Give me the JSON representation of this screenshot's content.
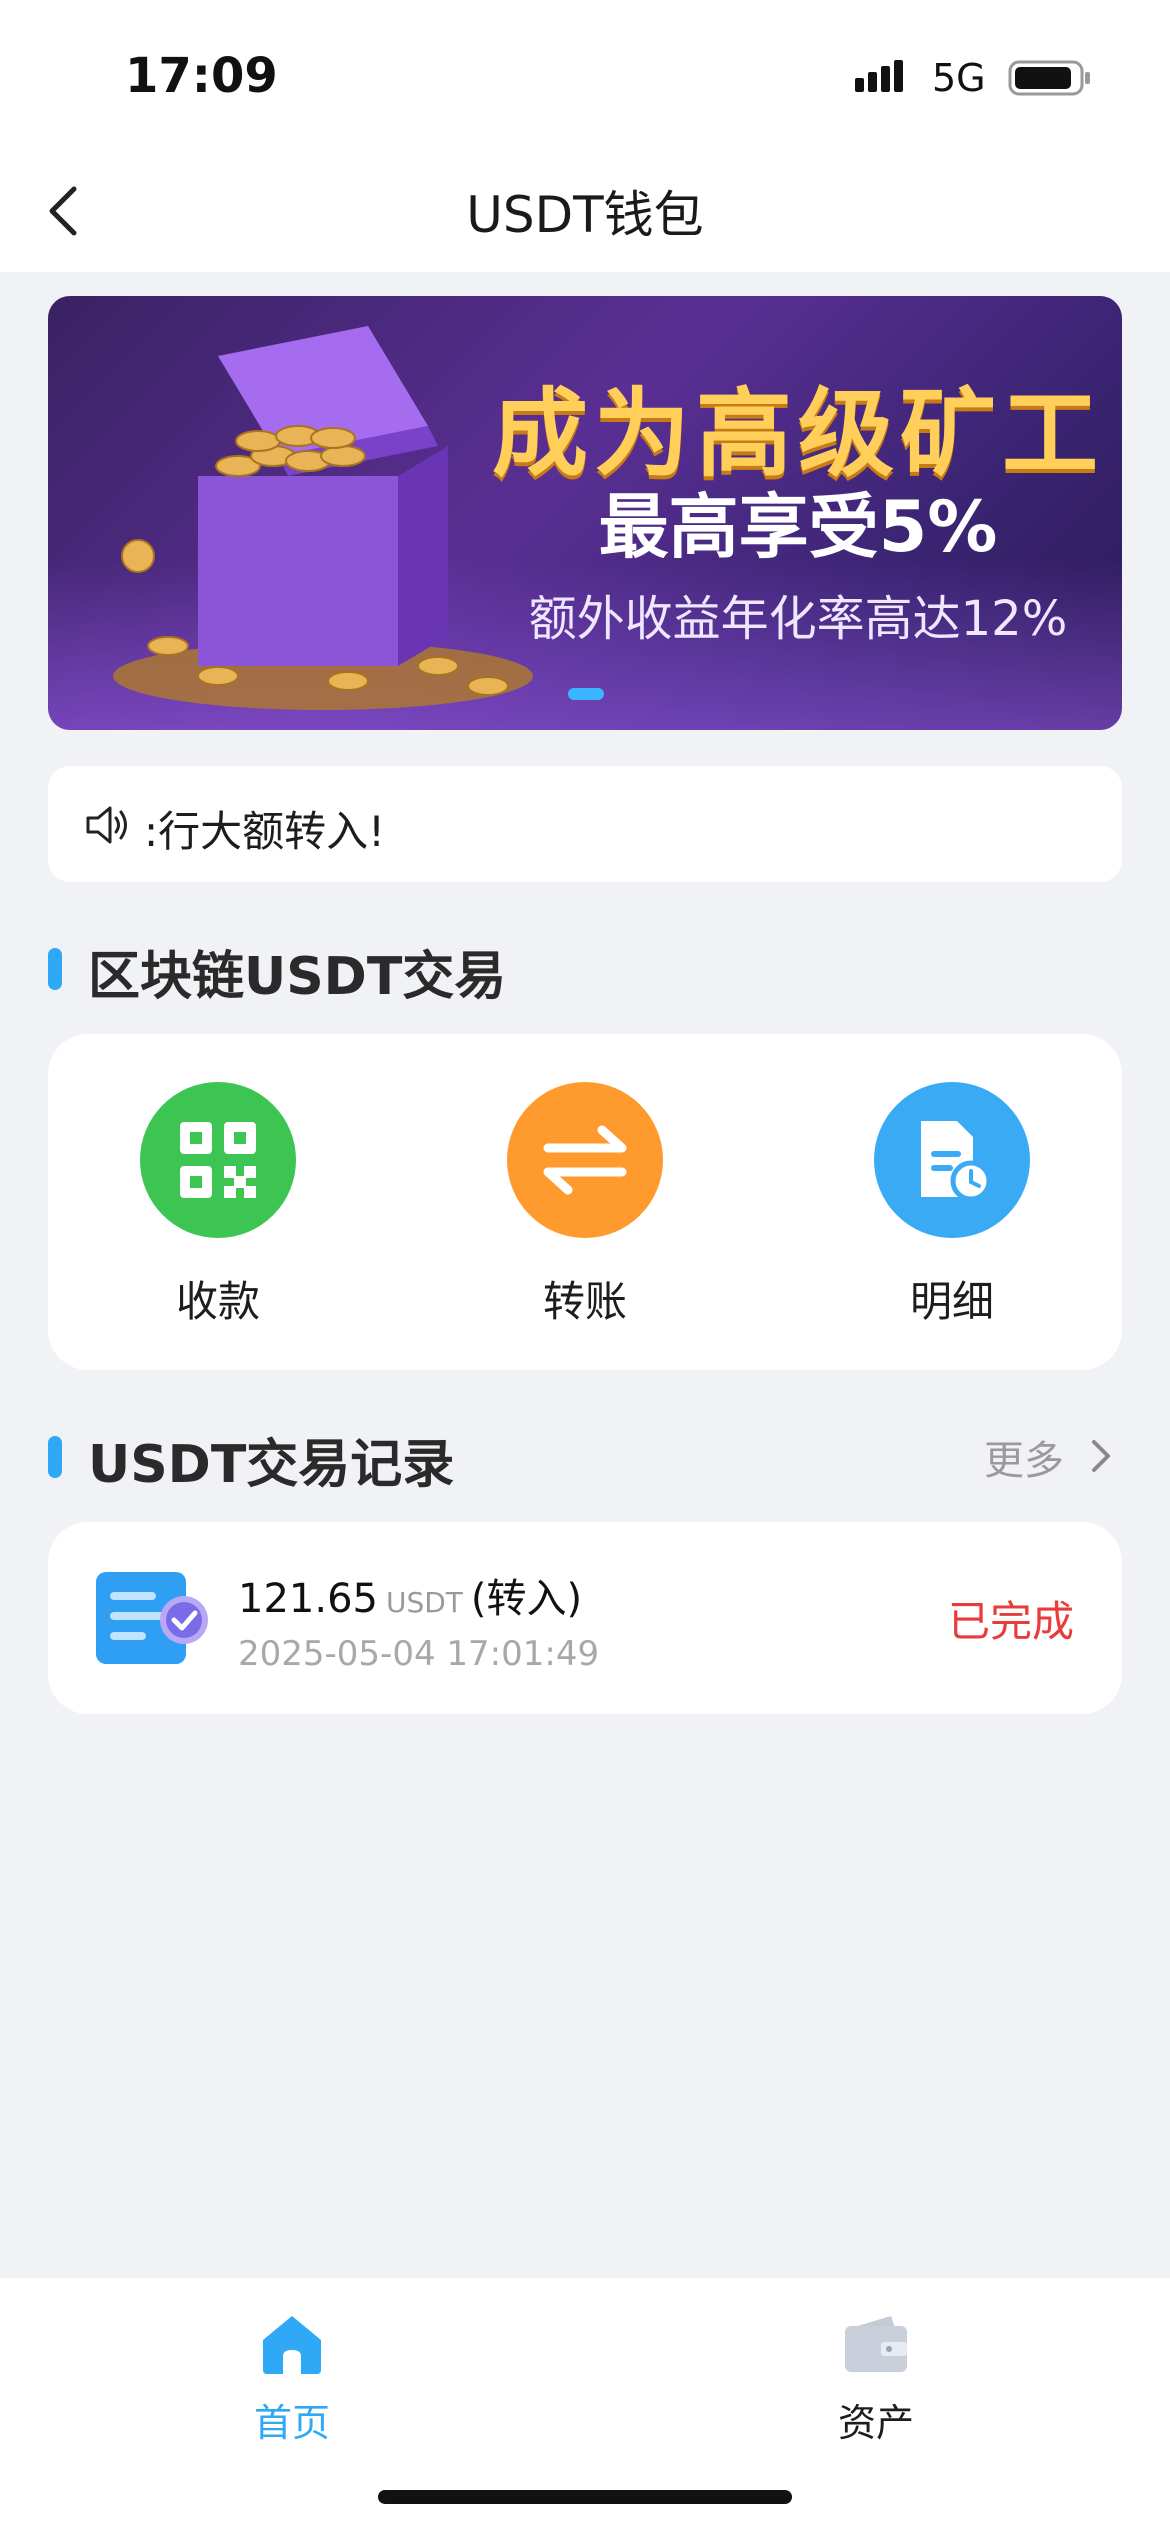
{
  "status_bar": {
    "time": "17:09",
    "network": "5G"
  },
  "header": {
    "title": "USDT钱包"
  },
  "banner": {
    "title": "成为高级矿工",
    "subtitle": "最高享受5%",
    "note": "额外收益年化率高达12%"
  },
  "notice": {
    "text": ":行大额转入!"
  },
  "section_trade": {
    "title": "区块链USDT交易"
  },
  "actions": [
    {
      "label": "收款",
      "color": "#3cc553"
    },
    {
      "label": "转账",
      "color": "#ff9a2e"
    },
    {
      "label": "明细",
      "color": "#3aaaf5"
    }
  ],
  "section_records": {
    "title": "USDT交易记录",
    "more_label": "更多"
  },
  "records": [
    {
      "amount": "121.65",
      "unit": "USDT",
      "direction": "(转入)",
      "time": "2025-05-04 17:01:49",
      "status": "已完成"
    }
  ],
  "tabbar": {
    "tabs": [
      {
        "label": "首页",
        "active": true
      },
      {
        "label": "资产",
        "active": false
      }
    ],
    "active_color": "#2fa8f6"
  }
}
